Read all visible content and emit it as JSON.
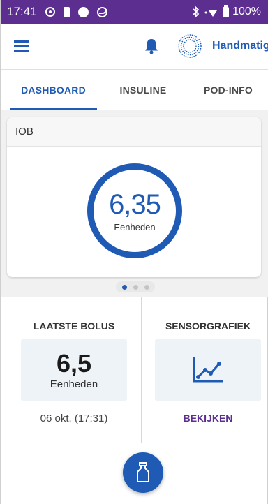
{
  "status_bar": {
    "time": "17:41",
    "battery": "100%"
  },
  "app_bar": {
    "mode_label": "Handmatig",
    "accent_color": "#1f5bb5"
  },
  "tabs": [
    {
      "label": "DASHBOARD",
      "active": true
    },
    {
      "label": "INSULINE",
      "active": false
    },
    {
      "label": "POD-INFO",
      "active": false
    }
  ],
  "iob": {
    "title": "IOB",
    "value": "6,35",
    "unit": "Eenheden"
  },
  "pager": {
    "count": 3,
    "active_index": 0
  },
  "last_bolus": {
    "title": "LAATSTE BOLUS",
    "value": "6,5",
    "unit": "Eenheden",
    "time": "06 okt. (17:31)"
  },
  "sensor": {
    "title": "SENSORGRAFIEK",
    "link": "BEKIJKEN",
    "link_color": "#5b2e8f"
  },
  "icons": {
    "menu": "menu-icon",
    "bell": "bell-icon",
    "profile": "profile-ring-icon",
    "sensor_graph": "graph-icon",
    "bolus": "insulin-vial-icon"
  }
}
